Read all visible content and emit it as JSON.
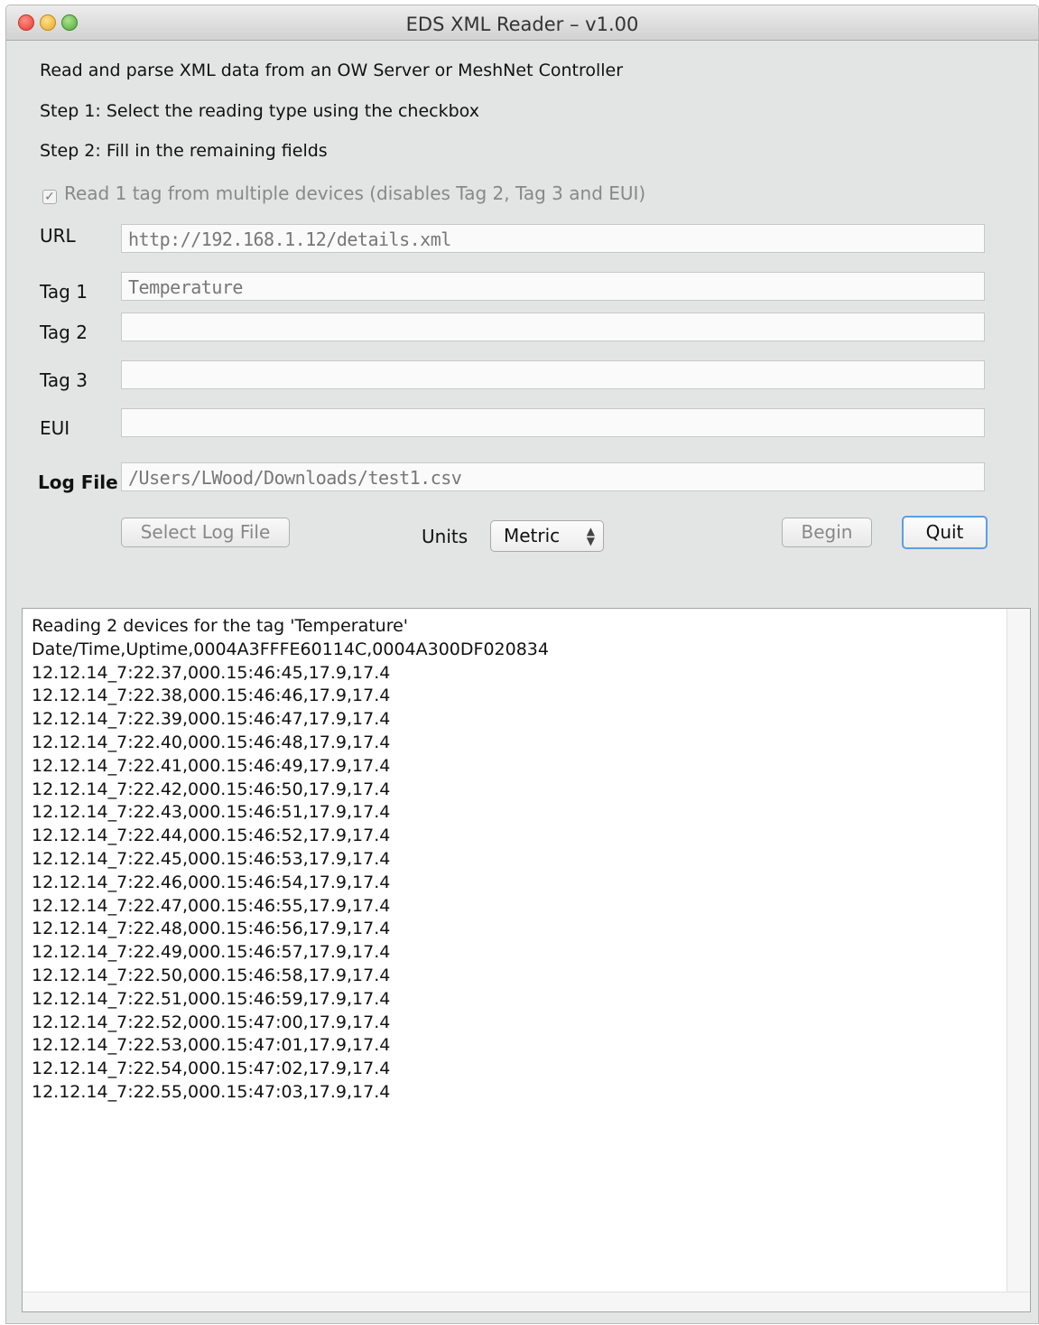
{
  "window": {
    "title": "EDS XML Reader – v1.00"
  },
  "instructions": {
    "line1": "Read and parse XML data from an OW Server or MeshNet Controller",
    "line2": "Step 1: Select the reading type using the checkbox",
    "line3": "Step 2: Fill in the remaining fields"
  },
  "checkbox": {
    "label": "Read 1 tag from multiple devices (disables Tag 2, Tag 3 and EUI)",
    "checked": true,
    "mark": "✓"
  },
  "fields": {
    "url": {
      "label": "URL",
      "value": "http://192.168.1.12/details.xml"
    },
    "tag1": {
      "label": "Tag 1",
      "value": "Temperature"
    },
    "tag2": {
      "label": "Tag 2",
      "value": ""
    },
    "tag3": {
      "label": "Tag 3",
      "value": ""
    },
    "eui": {
      "label": "EUI",
      "value": ""
    },
    "log_file": {
      "label": "Log File",
      "value": "/Users/LWood/Downloads/test1.csv"
    }
  },
  "controls": {
    "select_log_file_label": "Select Log File",
    "units_label": "Units",
    "units_value": "Metric",
    "begin_label": "Begin",
    "quit_label": "Quit"
  },
  "log": {
    "lines": [
      "Reading 2 devices for the tag 'Temperature'",
      "Date/Time,Uptime,0004A3FFFE60114C,0004A300DF020834",
      "12.12.14_7:22.37,000.15:46:45,17.9,17.4",
      "12.12.14_7:22.38,000.15:46:46,17.9,17.4",
      "12.12.14_7:22.39,000.15:46:47,17.9,17.4",
      "12.12.14_7:22.40,000.15:46:48,17.9,17.4",
      "12.12.14_7:22.41,000.15:46:49,17.9,17.4",
      "12.12.14_7:22.42,000.15:46:50,17.9,17.4",
      "12.12.14_7:22.43,000.15:46:51,17.9,17.4",
      "12.12.14_7:22.44,000.15:46:52,17.9,17.4",
      "12.12.14_7:22.45,000.15:46:53,17.9,17.4",
      "12.12.14_7:22.46,000.15:46:54,17.9,17.4",
      "12.12.14_7:22.47,000.15:46:55,17.9,17.4",
      "12.12.14_7:22.48,000.15:46:56,17.9,17.4",
      "12.12.14_7:22.49,000.15:46:57,17.9,17.4",
      "12.12.14_7:22.50,000.15:46:58,17.9,17.4",
      "12.12.14_7:22.51,000.15:46:59,17.9,17.4",
      "12.12.14_7:22.52,000.15:47:00,17.9,17.4",
      "12.12.14_7:22.53,000.15:47:01,17.9,17.4",
      "12.12.14_7:22.54,000.15:47:02,17.9,17.4",
      "12.12.14_7:22.55,000.15:47:03,17.9,17.4"
    ]
  }
}
